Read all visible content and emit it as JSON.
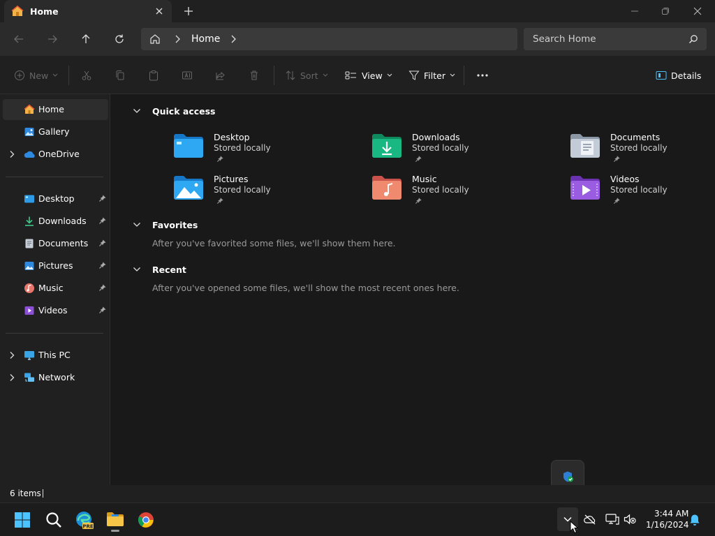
{
  "window": {
    "tab_title": "Home",
    "controls": [
      "minimize",
      "restore",
      "close"
    ]
  },
  "address": {
    "breadcrumb": [
      "Home"
    ],
    "search_placeholder": "Search Home"
  },
  "commands": {
    "new": "New",
    "sort": "Sort",
    "view": "View",
    "filter": "Filter",
    "details": "Details"
  },
  "sidebar": {
    "top": [
      {
        "label": "Home",
        "icon": "home-icon"
      },
      {
        "label": "Gallery",
        "icon": "gallery-icon"
      },
      {
        "label": "OneDrive",
        "icon": "onedrive-icon"
      }
    ],
    "pinned": [
      {
        "label": "Desktop",
        "icon": "desktop-folder-icon"
      },
      {
        "label": "Downloads",
        "icon": "downloads-icon"
      },
      {
        "label": "Documents",
        "icon": "documents-icon"
      },
      {
        "label": "Pictures",
        "icon": "pictures-icon"
      },
      {
        "label": "Music",
        "icon": "music-icon"
      },
      {
        "label": "Videos",
        "icon": "videos-icon"
      }
    ],
    "bottom": [
      {
        "label": "This PC",
        "icon": "this-pc-icon"
      },
      {
        "label": "Network",
        "icon": "network-icon"
      }
    ]
  },
  "main": {
    "quick_access": {
      "title": "Quick access",
      "items": [
        {
          "name": "Desktop",
          "sub": "Stored locally",
          "icon": "desktop-folder-icon"
        },
        {
          "name": "Downloads",
          "sub": "Stored locally",
          "icon": "downloads-folder-icon"
        },
        {
          "name": "Documents",
          "sub": "Stored locally",
          "icon": "documents-folder-icon"
        },
        {
          "name": "Pictures",
          "sub": "Stored locally",
          "icon": "pictures-folder-icon"
        },
        {
          "name": "Music",
          "sub": "Stored locally",
          "icon": "music-folder-icon"
        },
        {
          "name": "Videos",
          "sub": "Stored locally",
          "icon": "videos-folder-icon"
        }
      ]
    },
    "favorites": {
      "title": "Favorites",
      "message": "After you've favorited some files, we'll show them here."
    },
    "recent": {
      "title": "Recent",
      "message": "After you've opened some files, we'll show the most recent ones here."
    }
  },
  "status": {
    "items": "6 items"
  },
  "taskbar": {
    "apps": [
      "windows-start-icon",
      "search-icon",
      "edge-beta-icon",
      "file-explorer-icon",
      "chrome-icon"
    ],
    "time": "3:44 AM",
    "date": "1/16/2024"
  },
  "colors": {
    "accent": "#4cc2ff",
    "window_bg": "#191919",
    "pane_bg": "#202020"
  }
}
